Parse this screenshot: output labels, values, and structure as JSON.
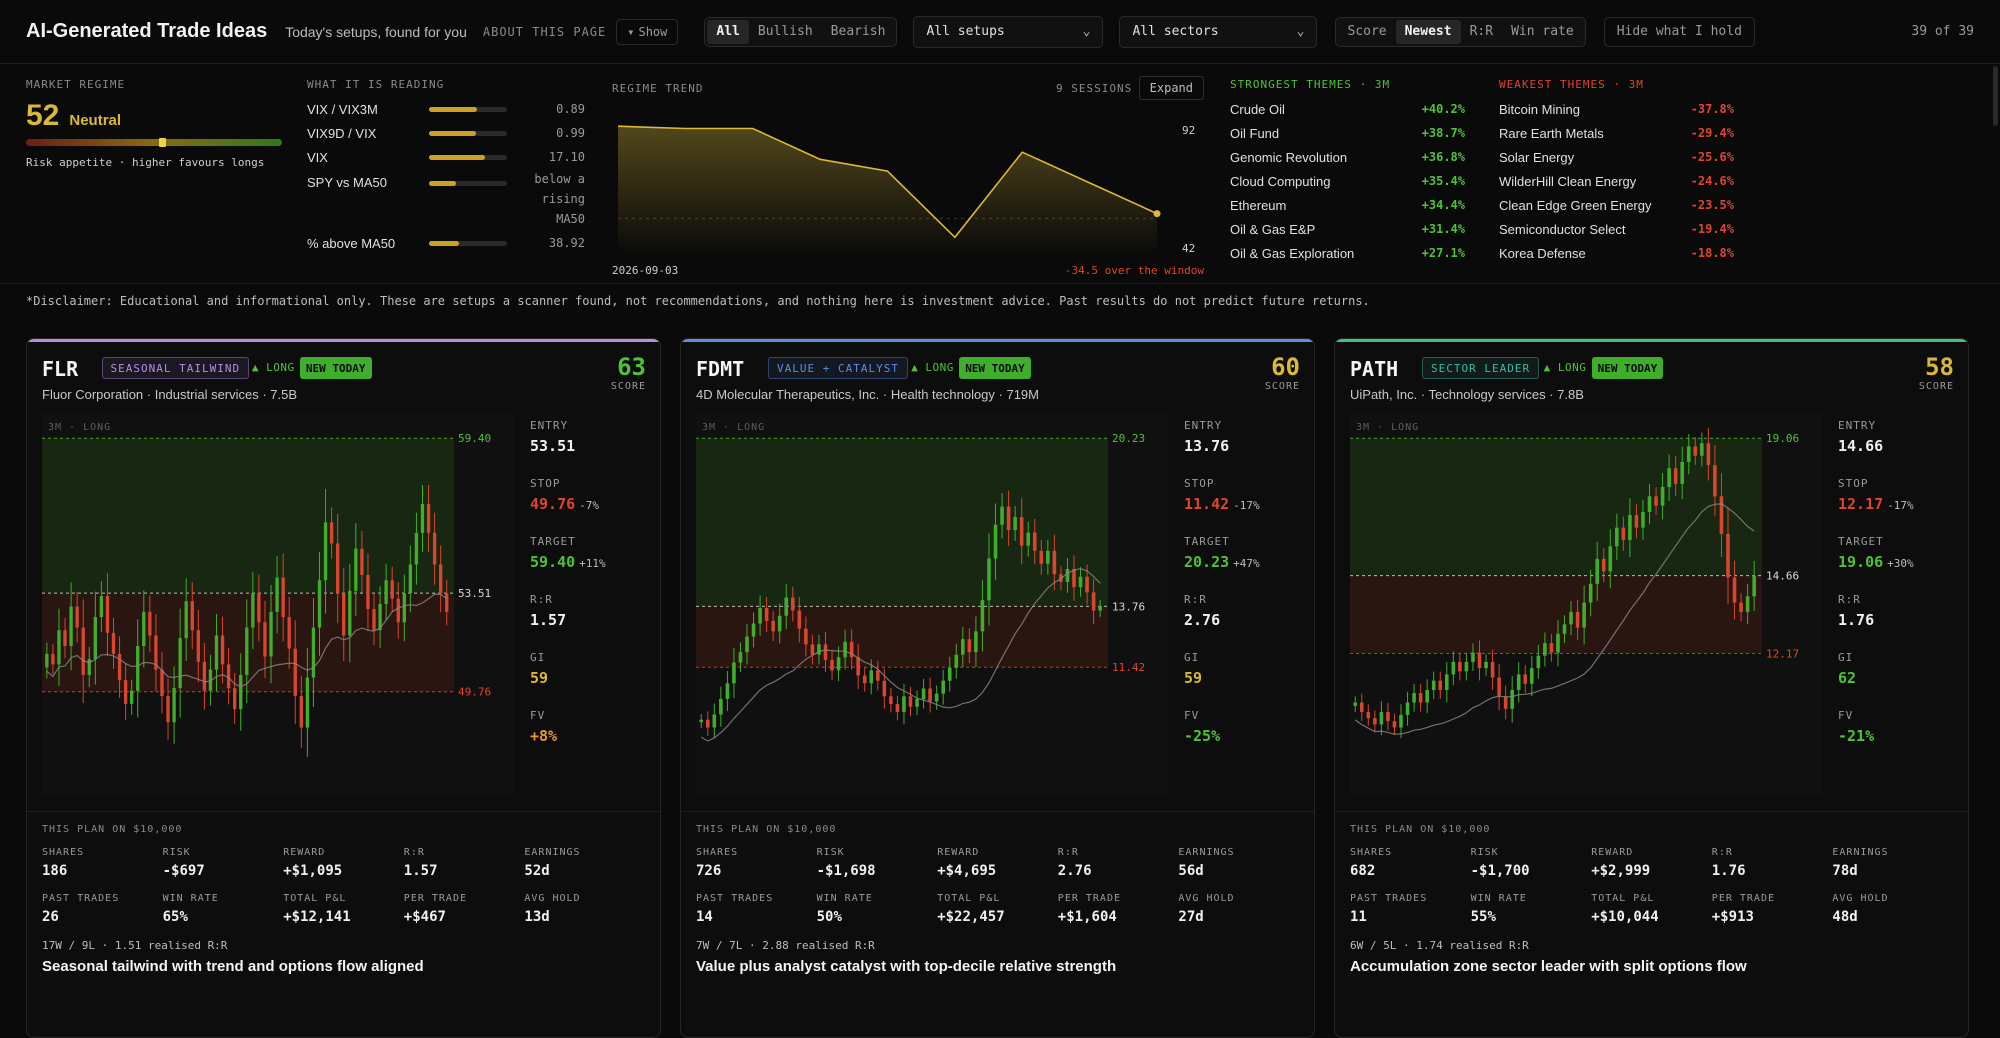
{
  "header": {
    "title": "AI-Generated Trade Ideas",
    "subtitle": "Today's setups, found for you",
    "about": "ABOUT THIS PAGE",
    "show_label": "Show",
    "direction_tabs": [
      "All",
      "Bullish",
      "Bearish"
    ],
    "setups_select": "All setups",
    "sectors_select": "All sectors",
    "sort_tabs": [
      "Score",
      "Newest",
      "R:R",
      "Win rate"
    ],
    "hide_label": "Hide what I hold",
    "count": "39 of 39"
  },
  "regime": {
    "label": "MARKET REGIME",
    "value": "52",
    "state": "Neutral",
    "gauge_fraction": 0.52,
    "caption": "Risk appetite · higher favours longs"
  },
  "reading": {
    "label": "WHAT IT IS READING",
    "rows": [
      {
        "name": "VIX / VIX3M",
        "value": "0.89",
        "fraction": 0.62
      },
      {
        "name": "VIX9D / VIX",
        "value": "0.99",
        "fraction": 0.6
      },
      {
        "name": "VIX",
        "value": "17.10",
        "fraction": 0.72
      },
      {
        "name": "SPY vs MA50",
        "value": "below a rising MA50",
        "fraction": 0.35
      },
      {
        "name": "% above MA50",
        "value": "38.92",
        "fraction": 0.38
      }
    ]
  },
  "trend": {
    "label": "REGIME TREND",
    "sessions": "9 SESSIONS",
    "expand": "Expand",
    "max_label": "92",
    "min_label": "42",
    "start_date": "2026-09-03",
    "change": "-34.5 over the window",
    "values": [
      89,
      88,
      88,
      75,
      70,
      42,
      78,
      65,
      52
    ]
  },
  "strongest": {
    "label": "STRONGEST THEMES · 3M",
    "items": [
      {
        "name": "Crude Oil",
        "value": "+40.2%"
      },
      {
        "name": "Oil Fund",
        "value": "+38.7%"
      },
      {
        "name": "Genomic Revolution",
        "value": "+36.8%"
      },
      {
        "name": "Cloud Computing",
        "value": "+35.4%"
      },
      {
        "name": "Ethereum",
        "value": "+34.4%"
      },
      {
        "name": "Oil & Gas E&P",
        "value": "+31.4%"
      },
      {
        "name": "Oil & Gas Exploration",
        "value": "+27.1%"
      }
    ]
  },
  "weakest": {
    "label": "WEAKEST THEMES · 3M",
    "items": [
      {
        "name": "Bitcoin Mining",
        "value": "-37.8%"
      },
      {
        "name": "Rare Earth Metals",
        "value": "-29.4%"
      },
      {
        "name": "Solar Energy",
        "value": "-25.6%"
      },
      {
        "name": "WilderHill Clean Energy",
        "value": "-24.6%"
      },
      {
        "name": "Clean Edge Green Energy",
        "value": "-23.5%"
      },
      {
        "name": "Semiconductor Select",
        "value": "-19.4%"
      },
      {
        "name": "Korea Defense",
        "value": "-18.8%"
      }
    ]
  },
  "disclaimer": "*Disclaimer: Educational and informational only. These are setups a scanner found, not recommendations, and nothing here is investment advice. Past results do not predict future returns.",
  "cards": [
    {
      "ticker": "FLR",
      "tag": "SEASONAL TAILWIND",
      "tag_color": "#b88be6",
      "accent": "#b88be6",
      "long": "▲ LONG",
      "new": "NEW TODAY",
      "score": "63",
      "score_color": "#4fc23a",
      "score_label": "SCORE",
      "company": "Fluor Corporation · Industrial services · 7.5B",
      "chart_label": "3M · LONG",
      "target_label": "59.40",
      "entry_label": "53.51",
      "stop_label": "49.76",
      "prices": [
        51.2,
        50.8,
        52.1,
        51.5,
        53.0,
        52.2,
        50.4,
        51.0,
        52.6,
        53.4,
        52.0,
        51.2,
        50.2,
        49.3,
        49.8,
        51.5,
        52.8,
        51.9,
        50.6,
        49.6,
        48.6,
        49.9,
        51.8,
        53.2,
        52.1,
        50.9,
        49.8,
        50.6,
        51.9,
        50.8,
        49.9,
        49.1,
        50.4,
        52.2,
        53.5,
        52.4,
        51.1,
        52.8,
        54.1,
        52.6,
        51.4,
        49.6,
        48.4,
        50.3,
        52.2,
        54.0,
        56.2,
        55.4,
        53.5,
        51.9,
        53.6,
        55.2,
        54.2,
        52.9,
        52.1,
        53.1,
        54.0,
        53.3,
        52.4,
        53.5,
        54.6,
        55.8,
        56.9,
        55.8,
        54.6,
        53.5,
        52.8
      ],
      "entry": "53.51",
      "stop": "49.76",
      "stop_pct": "-7%",
      "target": "59.40",
      "target_pct": "+11%",
      "rr": "1.57",
      "gi": "59",
      "gi_color": "#d9b83a",
      "fv": "+8%",
      "fv_color": "#e6982e",
      "plan_label": "THIS PLAN ON $10,000",
      "stats": [
        {
          "k": "SHARES",
          "v": "186",
          "c": ""
        },
        {
          "k": "RISK",
          "v": "-$697",
          "c": "red"
        },
        {
          "k": "REWARD",
          "v": "+$1,095",
          "c": "green"
        },
        {
          "k": "R:R",
          "v": "1.57",
          "c": ""
        },
        {
          "k": "EARNINGS",
          "v": "52d",
          "c": ""
        },
        {
          "k": "PAST TRADES",
          "v": "26",
          "c": ""
        },
        {
          "k": "WIN RATE",
          "v": "65%",
          "c": "green"
        },
        {
          "k": "TOTAL P&L",
          "v": "+$12,141",
          "c": "green"
        },
        {
          "k": "PER TRADE",
          "v": "+$467",
          "c": "green"
        },
        {
          "k": "AVG HOLD",
          "v": "13d",
          "c": ""
        }
      ],
      "record": "17W / 9L · 1.51 realised R:R",
      "headline": "Seasonal tailwind with trend and options flow aligned"
    },
    {
      "ticker": "FDMT",
      "tag": "VALUE + CATALYST",
      "tag_color": "#5b8de6",
      "accent": "#5b8de6",
      "long": "▲ LONG",
      "new": "NEW TODAY",
      "score": "60",
      "score_color": "#d9b83a",
      "score_label": "SCORE",
      "company": "4D Molecular Therapeutics, Inc. · Health technology · 719M",
      "chart_label": "3M · LONG",
      "target_label": "20.23",
      "entry_label": "13.76",
      "stop_label": "11.42",
      "prices": [
        9.4,
        9.1,
        9.6,
        10.2,
        10.8,
        11.6,
        12.0,
        12.6,
        13.1,
        13.7,
        13.2,
        12.8,
        13.4,
        14.1,
        13.6,
        12.9,
        12.3,
        11.9,
        12.3,
        11.7,
        11.3,
        11.8,
        12.4,
        11.8,
        11.1,
        10.8,
        11.3,
        10.9,
        10.3,
        10.0,
        9.7,
        10.3,
        9.9,
        10.2,
        10.6,
        10.1,
        10.4,
        10.9,
        11.4,
        11.9,
        12.5,
        12.0,
        12.8,
        14.0,
        15.6,
        16.9,
        17.6,
        16.7,
        17.2,
        16.1,
        16.6,
        15.9,
        15.4,
        15.9,
        15.0,
        14.7,
        15.2,
        14.5,
        14.9,
        14.3,
        13.6,
        13.76
      ],
      "entry": "13.76",
      "stop": "11.42",
      "stop_pct": "-17%",
      "target": "20.23",
      "target_pct": "+47%",
      "rr": "2.76",
      "gi": "59",
      "gi_color": "#d9b83a",
      "fv": "-25%",
      "fv_color": "#4fc23a",
      "plan_label": "THIS PLAN ON $10,000",
      "stats": [
        {
          "k": "SHARES",
          "v": "726",
          "c": ""
        },
        {
          "k": "RISK",
          "v": "-$1,698",
          "c": "red"
        },
        {
          "k": "REWARD",
          "v": "+$4,695",
          "c": "green"
        },
        {
          "k": "R:R",
          "v": "2.76",
          "c": ""
        },
        {
          "k": "EARNINGS",
          "v": "56d",
          "c": ""
        },
        {
          "k": "PAST TRADES",
          "v": "14",
          "c": ""
        },
        {
          "k": "WIN RATE",
          "v": "50%",
          "c": "green"
        },
        {
          "k": "TOTAL P&L",
          "v": "+$22,457",
          "c": "green"
        },
        {
          "k": "PER TRADE",
          "v": "+$1,604",
          "c": "green"
        },
        {
          "k": "AVG HOLD",
          "v": "27d",
          "c": ""
        }
      ],
      "record": "7W / 7L · 2.88 realised R:R",
      "headline": "Value plus analyst catalyst with top-decile relative strength"
    },
    {
      "ticker": "PATH",
      "tag": "SECTOR LEADER",
      "tag_color": "#3fb8a0",
      "accent": "#3fc27a",
      "long": "▲ LONG",
      "new": "NEW TODAY",
      "score": "58",
      "score_color": "#d9b83a",
      "score_label": "SCORE",
      "company": "UiPath, Inc. · Technology services · 7.8B",
      "chart_label": "3M · LONG",
      "target_label": "19.06",
      "entry_label": "14.66",
      "stop_label": "12.17",
      "prices": [
        10.6,
        10.3,
        10.1,
        9.9,
        10.3,
        10.0,
        9.8,
        10.2,
        10.6,
        10.9,
        10.6,
        11.0,
        11.3,
        11.0,
        11.5,
        11.9,
        11.6,
        11.9,
        12.2,
        11.7,
        11.9,
        11.4,
        10.8,
        10.4,
        11.0,
        11.5,
        11.2,
        11.7,
        12.1,
        12.5,
        12.2,
        12.8,
        13.1,
        13.5,
        13.0,
        13.8,
        14.4,
        15.2,
        14.8,
        15.6,
        16.2,
        15.8,
        16.6,
        16.2,
        16.7,
        17.2,
        16.9,
        17.5,
        18.1,
        17.6,
        18.3,
        18.8,
        18.5,
        18.9,
        18.2,
        17.2,
        16.0,
        14.6,
        13.8,
        13.5,
        14.0,
        14.66
      ],
      "entry": "14.66",
      "stop": "12.17",
      "stop_pct": "-17%",
      "target": "19.06",
      "target_pct": "+30%",
      "rr": "1.76",
      "gi": "62",
      "gi_color": "#4fc23a",
      "fv": "-21%",
      "fv_color": "#4fc23a",
      "plan_label": "THIS PLAN ON $10,000",
      "stats": [
        {
          "k": "SHARES",
          "v": "682",
          "c": ""
        },
        {
          "k": "RISK",
          "v": "-$1,700",
          "c": "red"
        },
        {
          "k": "REWARD",
          "v": "+$2,999",
          "c": "green"
        },
        {
          "k": "R:R",
          "v": "1.76",
          "c": ""
        },
        {
          "k": "EARNINGS",
          "v": "78d",
          "c": ""
        },
        {
          "k": "PAST TRADES",
          "v": "11",
          "c": ""
        },
        {
          "k": "WIN RATE",
          "v": "55%",
          "c": "green"
        },
        {
          "k": "TOTAL P&L",
          "v": "+$10,044",
          "c": "green"
        },
        {
          "k": "PER TRADE",
          "v": "+$913",
          "c": "green"
        },
        {
          "k": "AVG HOLD",
          "v": "48d",
          "c": ""
        }
      ],
      "record": "6W / 5L · 1.74 realised R:R",
      "headline": "Accumulation zone sector leader with split options flow"
    }
  ]
}
